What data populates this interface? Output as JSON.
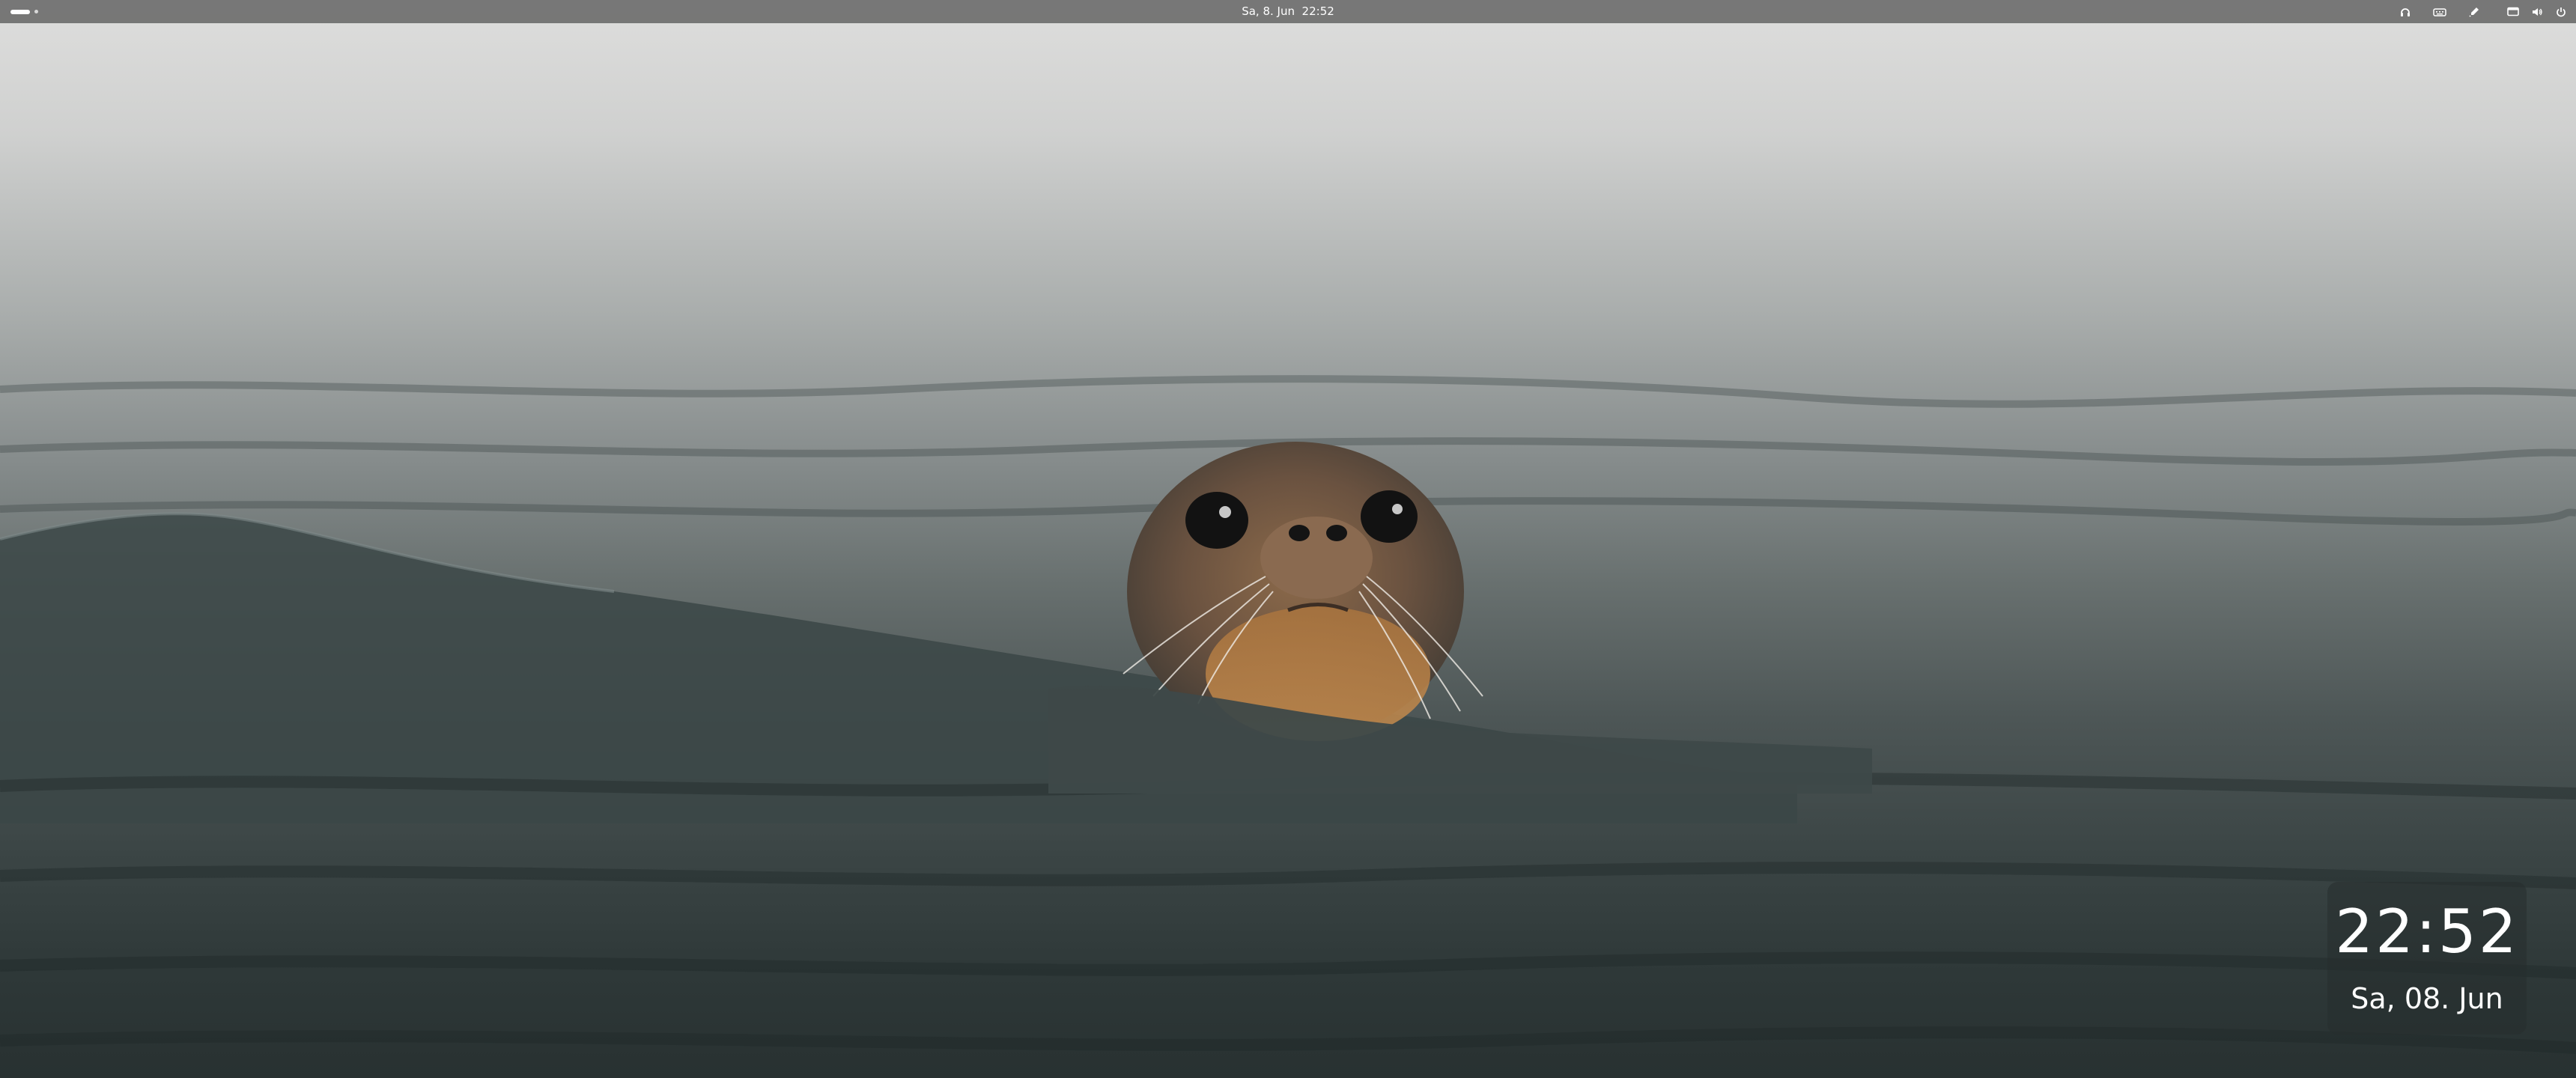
{
  "topbar": {
    "clock": {
      "date": "Sa, 8. Jun",
      "time": "22:52"
    },
    "tray_icons": [
      "headset-icon",
      "keyboard-icon",
      "color-picker-icon",
      "screen-icon",
      "volume-icon",
      "power-icon"
    ]
  },
  "desktop_widget": {
    "time": "22:52",
    "date": "Sa, 08. Jun"
  },
  "wallpaper": {
    "subject": "seal-in-water"
  },
  "colors": {
    "topbar_bg": "#6e6e6e",
    "text": "#ffffff"
  }
}
